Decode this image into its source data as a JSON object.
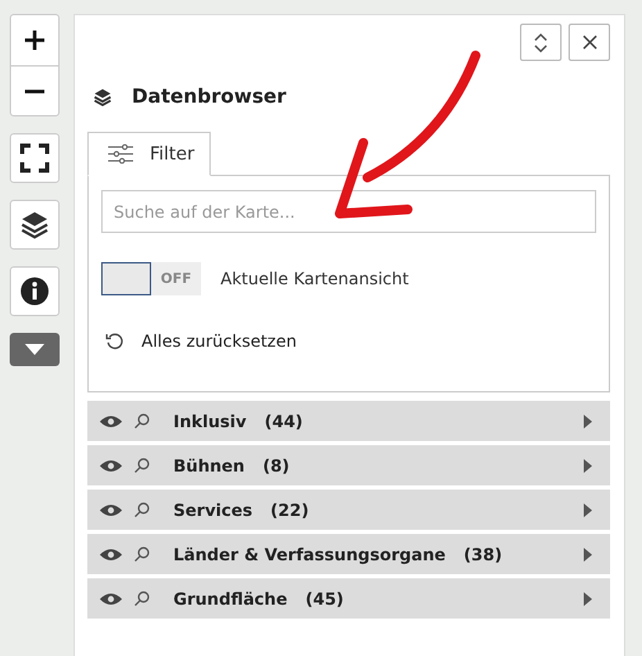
{
  "panel": {
    "title": "Datenbrowser"
  },
  "tabs": [
    {
      "label": "Filter",
      "selected": true
    }
  ],
  "search": {
    "placeholder": "Suche auf der Karte..."
  },
  "toggle": {
    "state_label": "OFF",
    "on": false,
    "label": "Aktuelle Kartenansicht"
  },
  "reset": {
    "label": "Alles zurücksetzen"
  },
  "categories": [
    {
      "name": "Inklusiv",
      "count": "(44)",
      "expanded": false
    },
    {
      "name": "Bühnen",
      "count": "(8)",
      "expanded": false
    },
    {
      "name": "Services",
      "count": "(22)",
      "expanded": false
    },
    {
      "name": "Länder & Verfassungsorgane",
      "count": "(38)",
      "expanded": false
    },
    {
      "name": "Grundfläche",
      "count": "(45)",
      "expanded": false
    }
  ]
}
